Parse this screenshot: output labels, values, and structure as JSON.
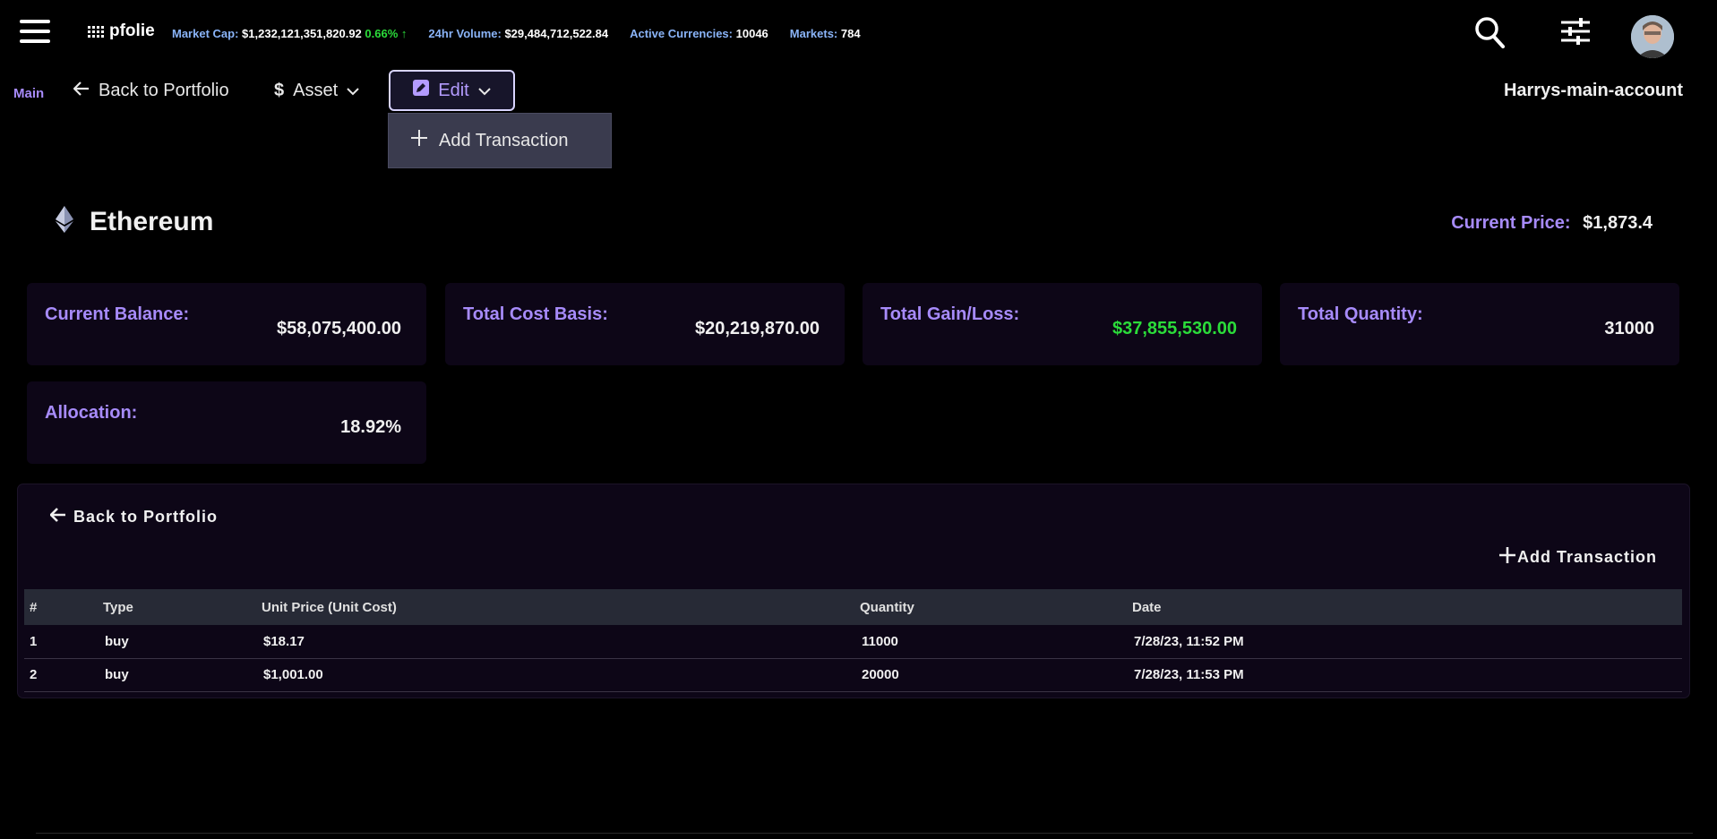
{
  "header": {
    "logo_text": "pfolie",
    "stats": [
      {
        "label": "Market Cap:",
        "value": "$1,232,121,351,820.92",
        "change": "0.66%"
      },
      {
        "label": "24hr Volume:",
        "value": "$29,484,712,522.84"
      },
      {
        "label": "Active Currencies:",
        "value": "10046"
      },
      {
        "label": "Markets:",
        "value": "784"
      }
    ]
  },
  "subnav": {
    "main_label": "Main",
    "back_label": "Back to Portfolio",
    "asset_label": "Asset",
    "edit_label": "Edit",
    "account_name": "Harrys-main-account"
  },
  "dropdown": {
    "items": [
      {
        "label": "Add Transaction"
      }
    ]
  },
  "asset": {
    "name": "Ethereum",
    "price_label": "Current Price:",
    "price_value": "$1,873.4"
  },
  "cards": [
    {
      "label": "Current Balance:",
      "value": "$58,075,400.00"
    },
    {
      "label": "Total Cost Basis:",
      "value": "$20,219,870.00"
    },
    {
      "label": "Total Gain/Loss:",
      "value": "$37,855,530.00"
    },
    {
      "label": "Total Quantity:",
      "value": "31000"
    },
    {
      "label": "Allocation:",
      "value": "18.92%"
    }
  ],
  "panel": {
    "back_label": "Back to Portfolio",
    "add_label": "Add Transaction",
    "columns": [
      "#",
      "Type",
      "Unit Price (Unit Cost)",
      "Quantity",
      "Date"
    ],
    "rows": [
      [
        "1",
        "buy",
        "$18.17",
        "11000",
        "7/28/23, 11:52 PM"
      ],
      [
        "2",
        "buy",
        "$1,001.00",
        "20000",
        "7/28/23, 11:53 PM"
      ]
    ]
  },
  "colors": {
    "accent": "#a78bfa",
    "positive": "#2bdc3a",
    "card_bg": "#0d0617"
  }
}
